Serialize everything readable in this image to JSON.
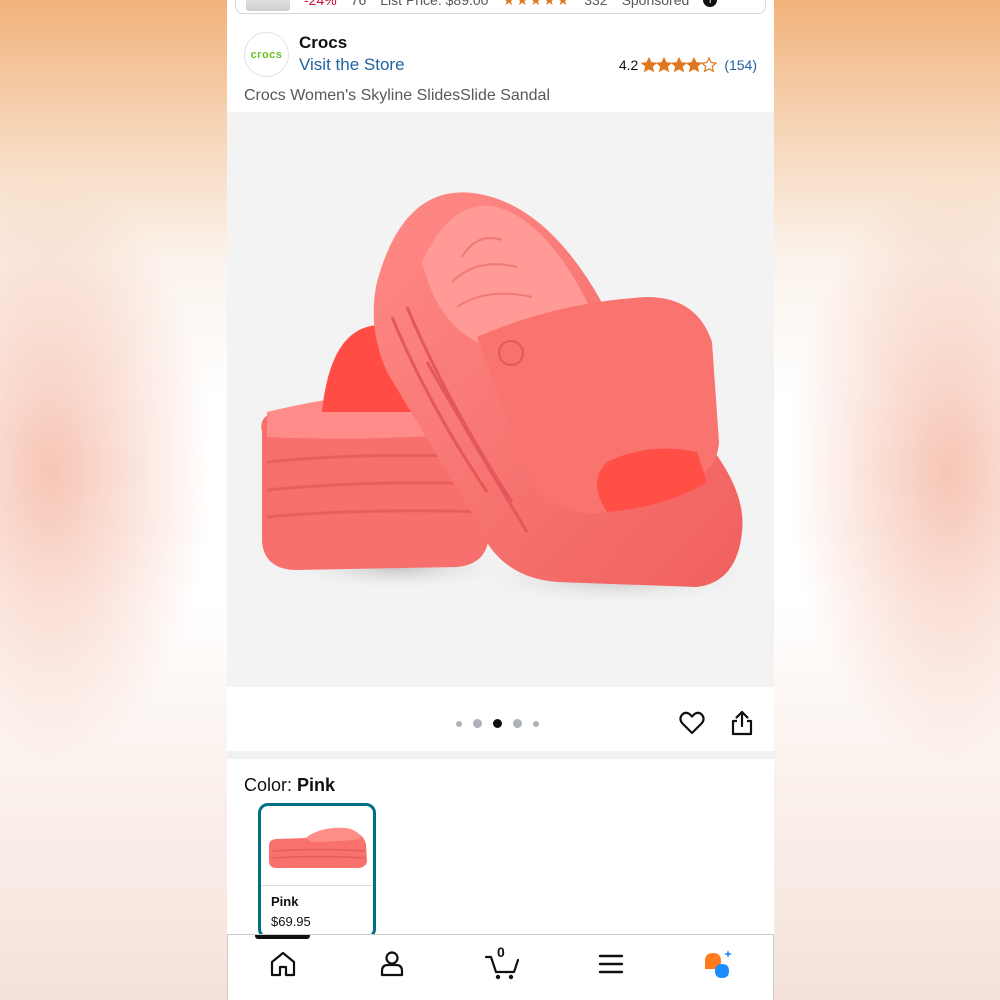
{
  "top_strip": {
    "discount": "-24%",
    "price_partial": "76",
    "list_price": "List Price: $89.00",
    "review_count": "332",
    "sponsored": "Sponsored"
  },
  "brand": {
    "logo_text": "crocs",
    "name": "Crocs",
    "visit_store": "Visit the Store",
    "rating_value": "4.2",
    "rating_stars": 4.2,
    "rating_count": "(154)"
  },
  "product": {
    "title": "Crocs Women's Skyline SlidesSlide Sandal",
    "color_main": "#f86e6c"
  },
  "gallery": {
    "image_count": 5,
    "active_index": 2
  },
  "color_selection": {
    "label": "Color: ",
    "value": "Pink",
    "swatches": [
      {
        "name": "Pink",
        "price": "$69.95",
        "selected": true
      }
    ]
  },
  "bottom_nav": {
    "items": [
      "home-icon",
      "account-icon",
      "cart-icon",
      "menu-icon",
      "assistant-icon"
    ],
    "cart_count": "0"
  },
  "colors": {
    "link": "#2162a1",
    "star": "#de7921",
    "selected_border": "#007185"
  }
}
